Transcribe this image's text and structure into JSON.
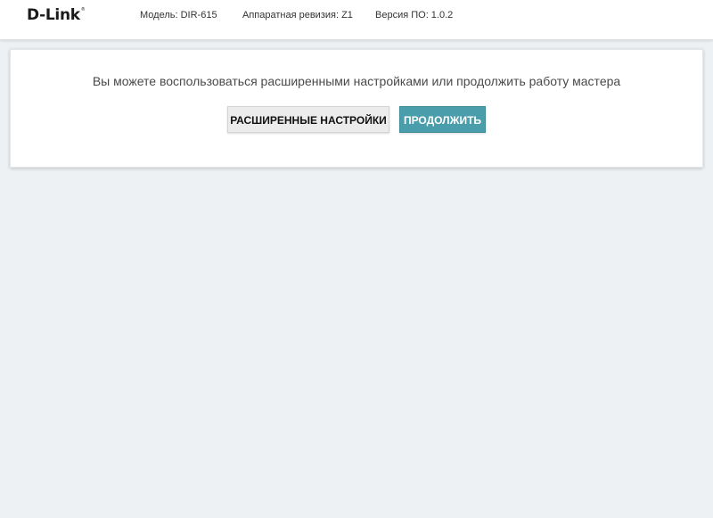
{
  "header": {
    "logo_text": "D-Link",
    "logo_mark": "®",
    "model": "Модель: DIR-615",
    "hardware_revision": "Аппаратная ревизия: Z1",
    "firmware_version": "Версия ПО: 1.0.2"
  },
  "panel": {
    "message": "Вы можете воспользоваться расширенными настройками или продолжить работу мастера",
    "advanced_button_label": "РАСШИРЕННЫЕ НАСТРОЙКИ",
    "continue_button_label": "ПРОДОЛЖИТЬ"
  },
  "colors": {
    "accent": "#4a9eab",
    "page_background": "#eef1f4"
  }
}
